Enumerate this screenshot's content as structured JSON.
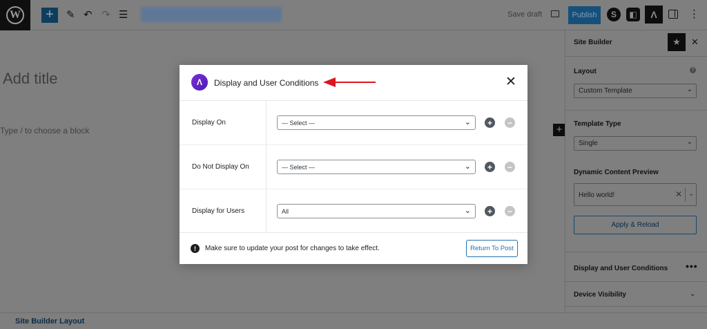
{
  "toolbar": {
    "save_draft_label": "Save draft",
    "publish_label": "Publish"
  },
  "canvas": {
    "title_placeholder": "Add title",
    "block_placeholder": "Type / to choose a block"
  },
  "bottom_bar": {
    "link_label": "Site Builder Layout"
  },
  "sidebar": {
    "title": "Site Builder",
    "layout": {
      "label": "Layout",
      "value": "Custom Template"
    },
    "template_type": {
      "label": "Template Type",
      "value": "Single"
    },
    "dynamic_preview": {
      "label": "Dynamic Content Preview",
      "value": "Hello world!"
    },
    "apply_label": "Apply & Reload",
    "display_conditions_label": "Display and User Conditions",
    "device_visibility_label": "Device Visibility"
  },
  "modal": {
    "title": "Display and User Conditions",
    "rows": [
      {
        "label": "Display On",
        "value": "— Select —"
      },
      {
        "label": "Do Not Display On",
        "value": "— Select —"
      },
      {
        "label": "Display for Users",
        "value": "All"
      }
    ],
    "notice": "Make sure to update your post for changes to take effect.",
    "return_label": "Return To Post"
  },
  "colors": {
    "overlay": "#7f7f7f",
    "accent": "#2271b1",
    "astra_purple": "#6a24cc",
    "annotation_arrow": "#e0141e"
  }
}
